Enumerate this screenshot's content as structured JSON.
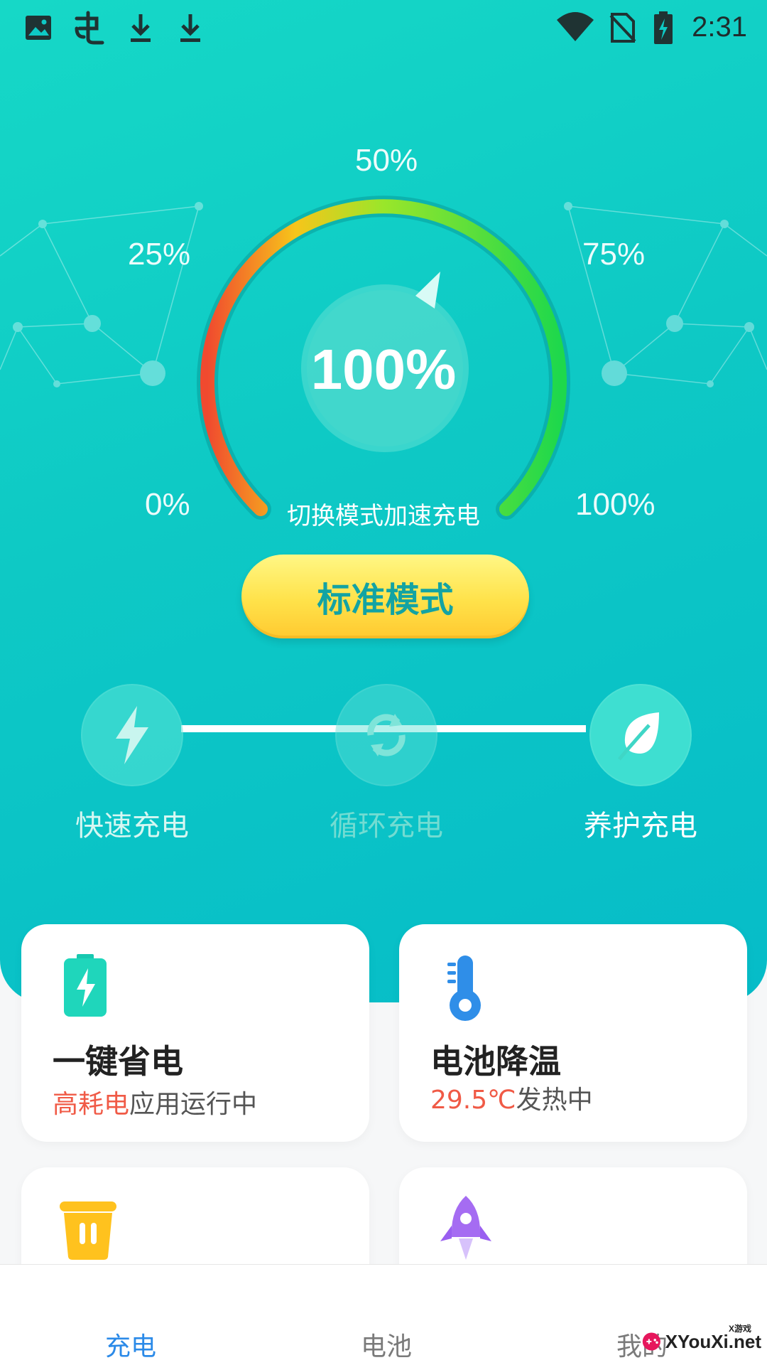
{
  "status_bar": {
    "time": "2:31",
    "left_icons": [
      "image-icon",
      "app-icon",
      "download-icon",
      "download-icon"
    ],
    "right_icons": [
      "wifi-icon",
      "no-sim-icon",
      "battery-charging-icon"
    ]
  },
  "gauge": {
    "labels": {
      "p0": "0%",
      "p25": "25%",
      "p50": "50%",
      "p75": "75%",
      "p100": "100%"
    },
    "center_value": "100%",
    "level": 100,
    "hint": "切换模式加速充电",
    "gradient_colors": [
      "#f04a2f",
      "#f7c51a",
      "#a6e82a",
      "#22d84a"
    ]
  },
  "mode_button": {
    "label": "标准模式"
  },
  "modes": [
    {
      "label": "快速充电",
      "icon": "lightning-icon",
      "state": "dim"
    },
    {
      "label": "循环充电",
      "icon": "cycle-icon",
      "state": "faded"
    },
    {
      "label": "养护充电",
      "icon": "leaf-icon",
      "state": "active"
    }
  ],
  "cards": [
    {
      "title": "一键省电",
      "sub_highlight": "高耗电",
      "sub_rest": "应用运行中",
      "icon": "battery-icon"
    },
    {
      "title": "电池降温",
      "sub_highlight": "29.5℃",
      "sub_rest": "发热中",
      "icon": "thermometer-icon"
    },
    {
      "title": "",
      "sub_highlight": "",
      "sub_rest": "",
      "icon": "trash-icon"
    },
    {
      "title": "",
      "sub_highlight": "",
      "sub_rest": "",
      "icon": "rocket-icon"
    }
  ],
  "bottom_nav": {
    "items": [
      {
        "label": "充电",
        "active": true
      },
      {
        "label": "电池",
        "active": false
      },
      {
        "label": "我的",
        "active": false
      }
    ]
  },
  "watermark": {
    "text": "XYouXi.net",
    "small": "X游戏"
  },
  "colors": {
    "accent_teal": "#0ec9c5",
    "nav_active": "#2b8ae8",
    "highlight_red": "#f05a46",
    "button_yellow": "#ffe24a"
  }
}
